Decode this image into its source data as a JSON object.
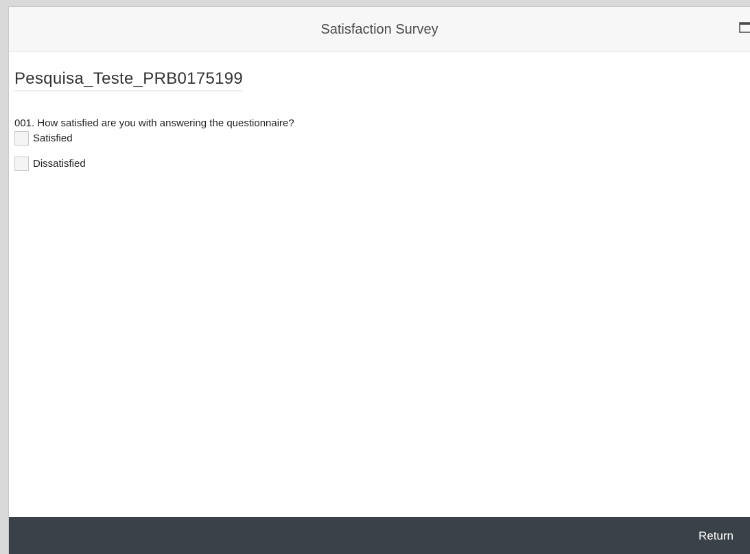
{
  "dialog": {
    "title": "Satisfaction Survey",
    "maximize_icon": "maximize-window-icon"
  },
  "survey": {
    "title": "Pesquisa_Teste_PRB0175199",
    "questions": [
      {
        "text": "001. How satisfied are you with answering the questionnaire?",
        "options": [
          {
            "label": "Satisfied",
            "checked": false
          },
          {
            "label": "Dissatisfied",
            "checked": false
          }
        ]
      }
    ]
  },
  "footer": {
    "return_label": "Return"
  },
  "colors": {
    "footer_bg": "#3b4148",
    "titlebar_bg": "#f7f7f7",
    "page_bg": "#d9d9d9"
  }
}
